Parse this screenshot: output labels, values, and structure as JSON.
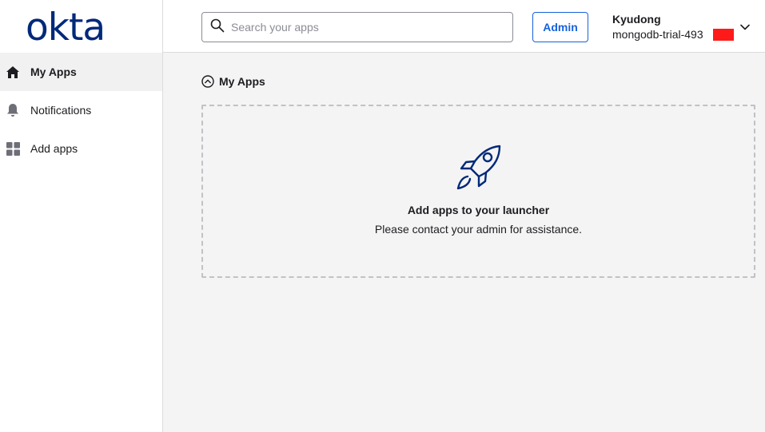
{
  "brand": {
    "logo_text": "okta",
    "logo_color": "#00297a"
  },
  "sidebar": {
    "items": [
      {
        "label": "My Apps",
        "icon": "home-icon",
        "active": true
      },
      {
        "label": "Notifications",
        "icon": "bell-icon",
        "active": false
      },
      {
        "label": "Add apps",
        "icon": "grid-icon",
        "active": false
      }
    ]
  },
  "header": {
    "search": {
      "placeholder": "Search your apps",
      "value": ""
    },
    "admin_label": "Admin",
    "user": {
      "name": "Kyudong",
      "org": "mongodb-trial-493"
    },
    "accent_color": "#1662dd"
  },
  "main": {
    "section_title": "My Apps",
    "empty_state": {
      "title": "Add apps to your launcher",
      "subtitle": "Please contact your admin for assistance.",
      "icon": "rocket-icon"
    }
  }
}
